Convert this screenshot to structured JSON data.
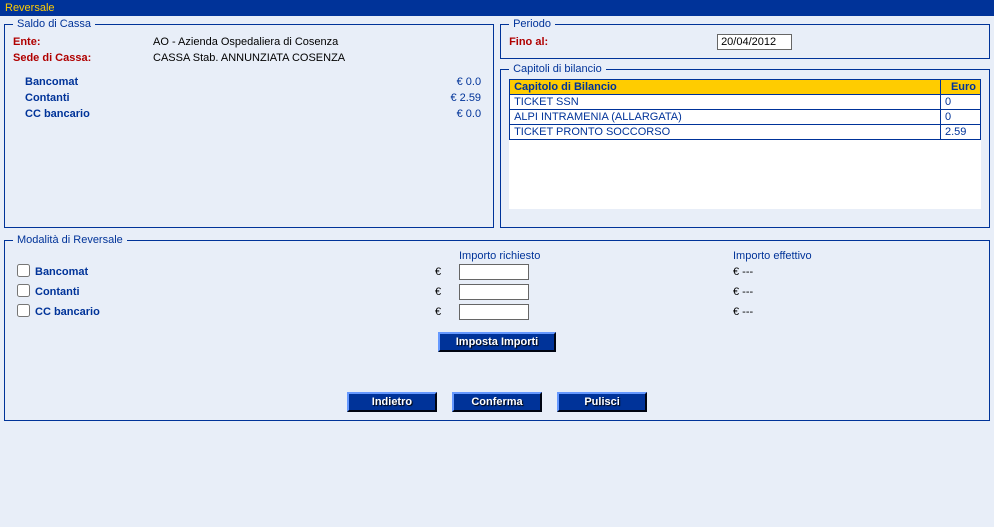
{
  "title_bar": "Reversale",
  "saldo": {
    "legend": "Saldo di Cassa",
    "ente_label": "Ente:",
    "ente_value": "AO - Azienda Ospedaliera di Cosenza",
    "sede_label": "Sede di Cassa:",
    "sede_value": "CASSA Stab. ANNUNZIATA COSENZA",
    "rows": [
      {
        "name": "Bancomat",
        "amount": "€ 0.0"
      },
      {
        "name": "Contanti",
        "amount": "€ 2.59"
      },
      {
        "name": "CC bancario",
        "amount": "€ 0.0"
      }
    ]
  },
  "periodo": {
    "legend": "Periodo",
    "fino_label": "Fino al:",
    "fino_value": "20/04/2012"
  },
  "capitoli": {
    "legend": "Capitoli di bilancio",
    "col_name": "Capitolo di Bilancio",
    "col_euro": "Euro",
    "rows": [
      {
        "name": "TICKET SSN",
        "euro": "0"
      },
      {
        "name": "ALPI INTRAMENIA (ALLARGATA)",
        "euro": "0"
      },
      {
        "name": "TICKET PRONTO SOCCORSO",
        "euro": "2.59"
      }
    ]
  },
  "modalita": {
    "legend": "Modalità di Reversale",
    "hdr_req": "Importo richiesto",
    "hdr_eff": "Importo effettivo",
    "currency": "€",
    "eff_placeholder": "€ ---",
    "rows": [
      {
        "name": "Bancomat"
      },
      {
        "name": "Contanti"
      },
      {
        "name": "CC bancario"
      }
    ],
    "btn_imposta": "Imposta Importi"
  },
  "footer": {
    "indietro": "Indietro",
    "conferma": "Conferma",
    "pulisci": "Pulisci"
  }
}
